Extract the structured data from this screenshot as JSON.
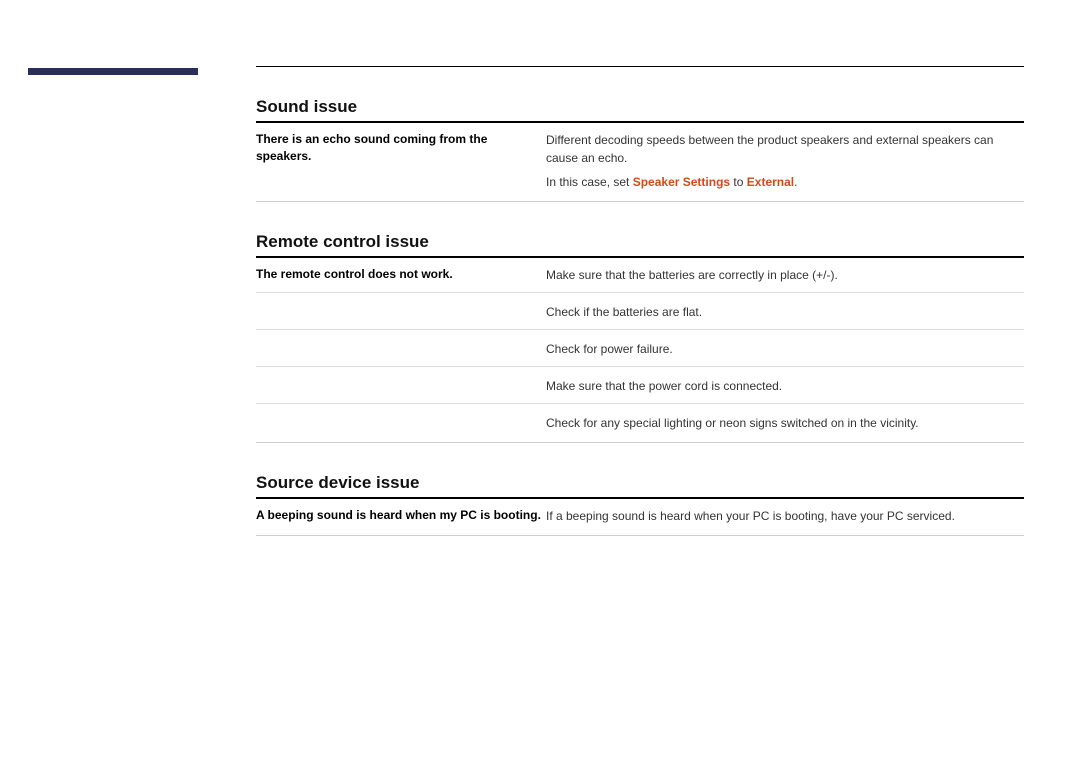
{
  "sections": {
    "sound": {
      "heading": "Sound issue",
      "row0": {
        "left": "There is an echo sound coming from the speakers.",
        "r0": "Different decoding speeds between the product speakers and external speakers can cause an echo.",
        "prefix": "In this case, set ",
        "hl1": "Speaker Settings",
        "mid": " to ",
        "hl2": "External",
        "suffix": "."
      }
    },
    "remote": {
      "heading": "Remote control issue",
      "row0": {
        "left": "The remote control does not work.",
        "right": "Make sure that the batteries are correctly in place (+/-)."
      },
      "row1": {
        "right": "Check if the batteries are flat."
      },
      "row2": {
        "right": "Check for power failure."
      },
      "row3": {
        "right": "Make sure that the power cord is connected."
      },
      "row4": {
        "right": "Check for any special lighting or neon signs switched on in the vicinity."
      }
    },
    "source": {
      "heading": "Source device issue",
      "row0": {
        "left": "A beeping sound is heard when my PC is booting.",
        "right": "If a beeping sound is heard when your PC is booting, have your PC serviced."
      }
    }
  }
}
